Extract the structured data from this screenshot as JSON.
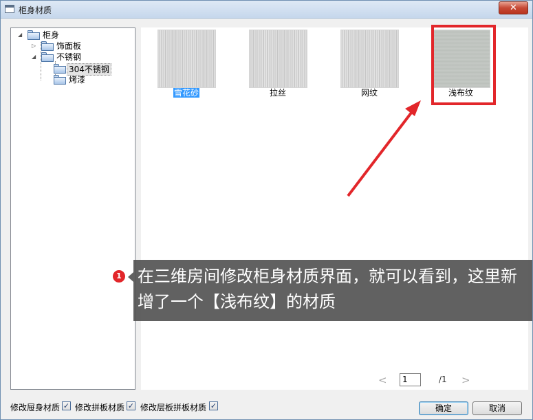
{
  "window": {
    "title": "柜身材质",
    "close_label": "✕"
  },
  "tree": {
    "root": "柜身",
    "children": [
      {
        "label": "饰面板"
      },
      {
        "label": "不锈钢",
        "children": [
          {
            "label": "304不锈钢",
            "selected": true
          },
          {
            "label": "烤漆"
          }
        ]
      }
    ]
  },
  "materials": [
    {
      "label": "雪花砂",
      "selected": true
    },
    {
      "label": "拉丝"
    },
    {
      "label": "网纹"
    },
    {
      "label": "浅布纹",
      "highlighted": true
    }
  ],
  "pager": {
    "prev": "<",
    "current": "1",
    "total": "/1",
    "next": ">"
  },
  "options": [
    {
      "label": "修改屉身材质",
      "checked": true
    },
    {
      "label": "修改拼板材质",
      "checked": true
    },
    {
      "label": "修改层板拼板材质",
      "checked": true
    }
  ],
  "buttons": {
    "ok": "确定",
    "cancel": "取消"
  },
  "annotation": {
    "badge": "1",
    "text": "在三维房间修改柜身材质界面，就可以看到，这里新增了一个【浅布纹】的材质",
    "color": "#e2262a"
  }
}
